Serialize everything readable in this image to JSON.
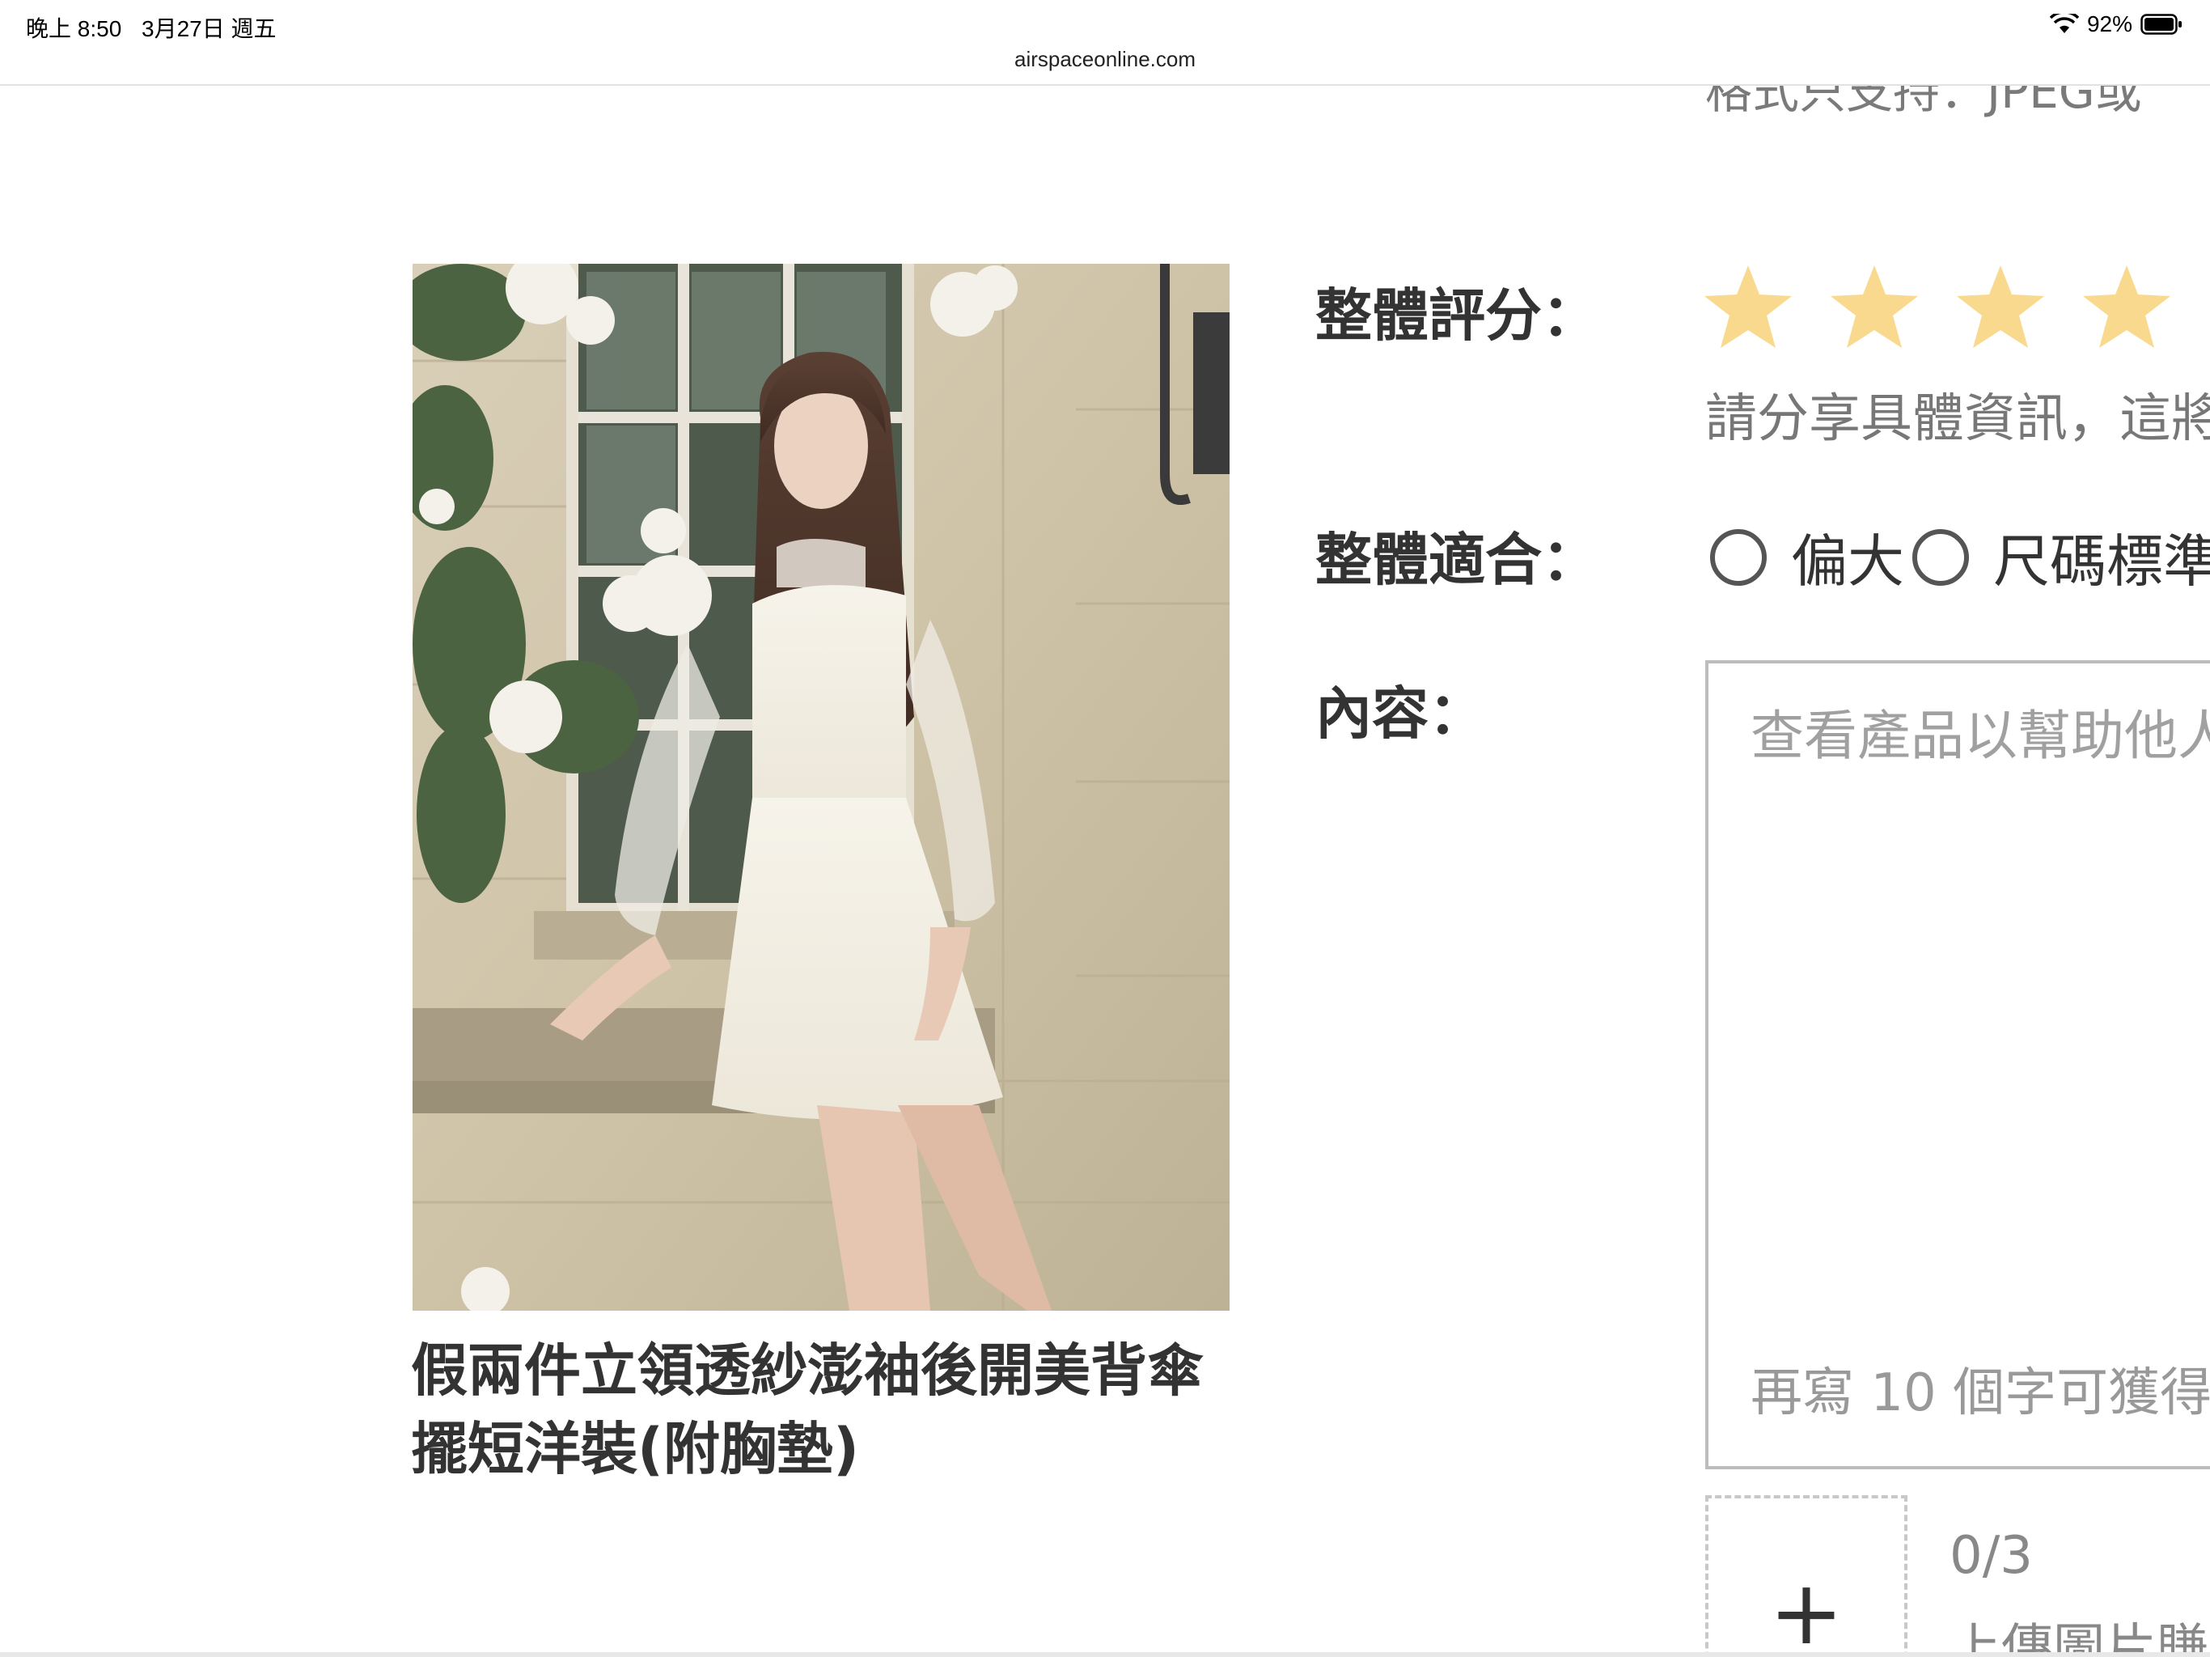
{
  "status_bar": {
    "time": "晚上 8:50",
    "date": "3月27日 週五",
    "battery": "92%",
    "wifi_icon": "wifi-icon",
    "battery_icon": "battery-icon"
  },
  "browser": {
    "url": "airspaceonline.com"
  },
  "page": {
    "cropped_top_text": "格式只支持：JPEG或",
    "product": {
      "title_line1": "假兩件立領透紗澎袖後開美背傘",
      "title_line2": "擺短洋裝(附胸墊)",
      "photo": "model-in-white-dress-photo"
    },
    "form": {
      "rating_label": "整體評分：",
      "rating_value": 4,
      "rating_max": 5,
      "rating_color": "#f8d98e",
      "rating_hint": "請分享具體資訊，這將",
      "fit_label": "整體適合：",
      "fit_options": [
        "偏大",
        "尺碼標準"
      ],
      "content_label": "內容：",
      "content_placeholder": "查看產品以幫助他人",
      "content_reward": "再寫 10 個字可獲得",
      "upload_count": "0/3",
      "upload_hint": "上傳圖片賺"
    }
  }
}
